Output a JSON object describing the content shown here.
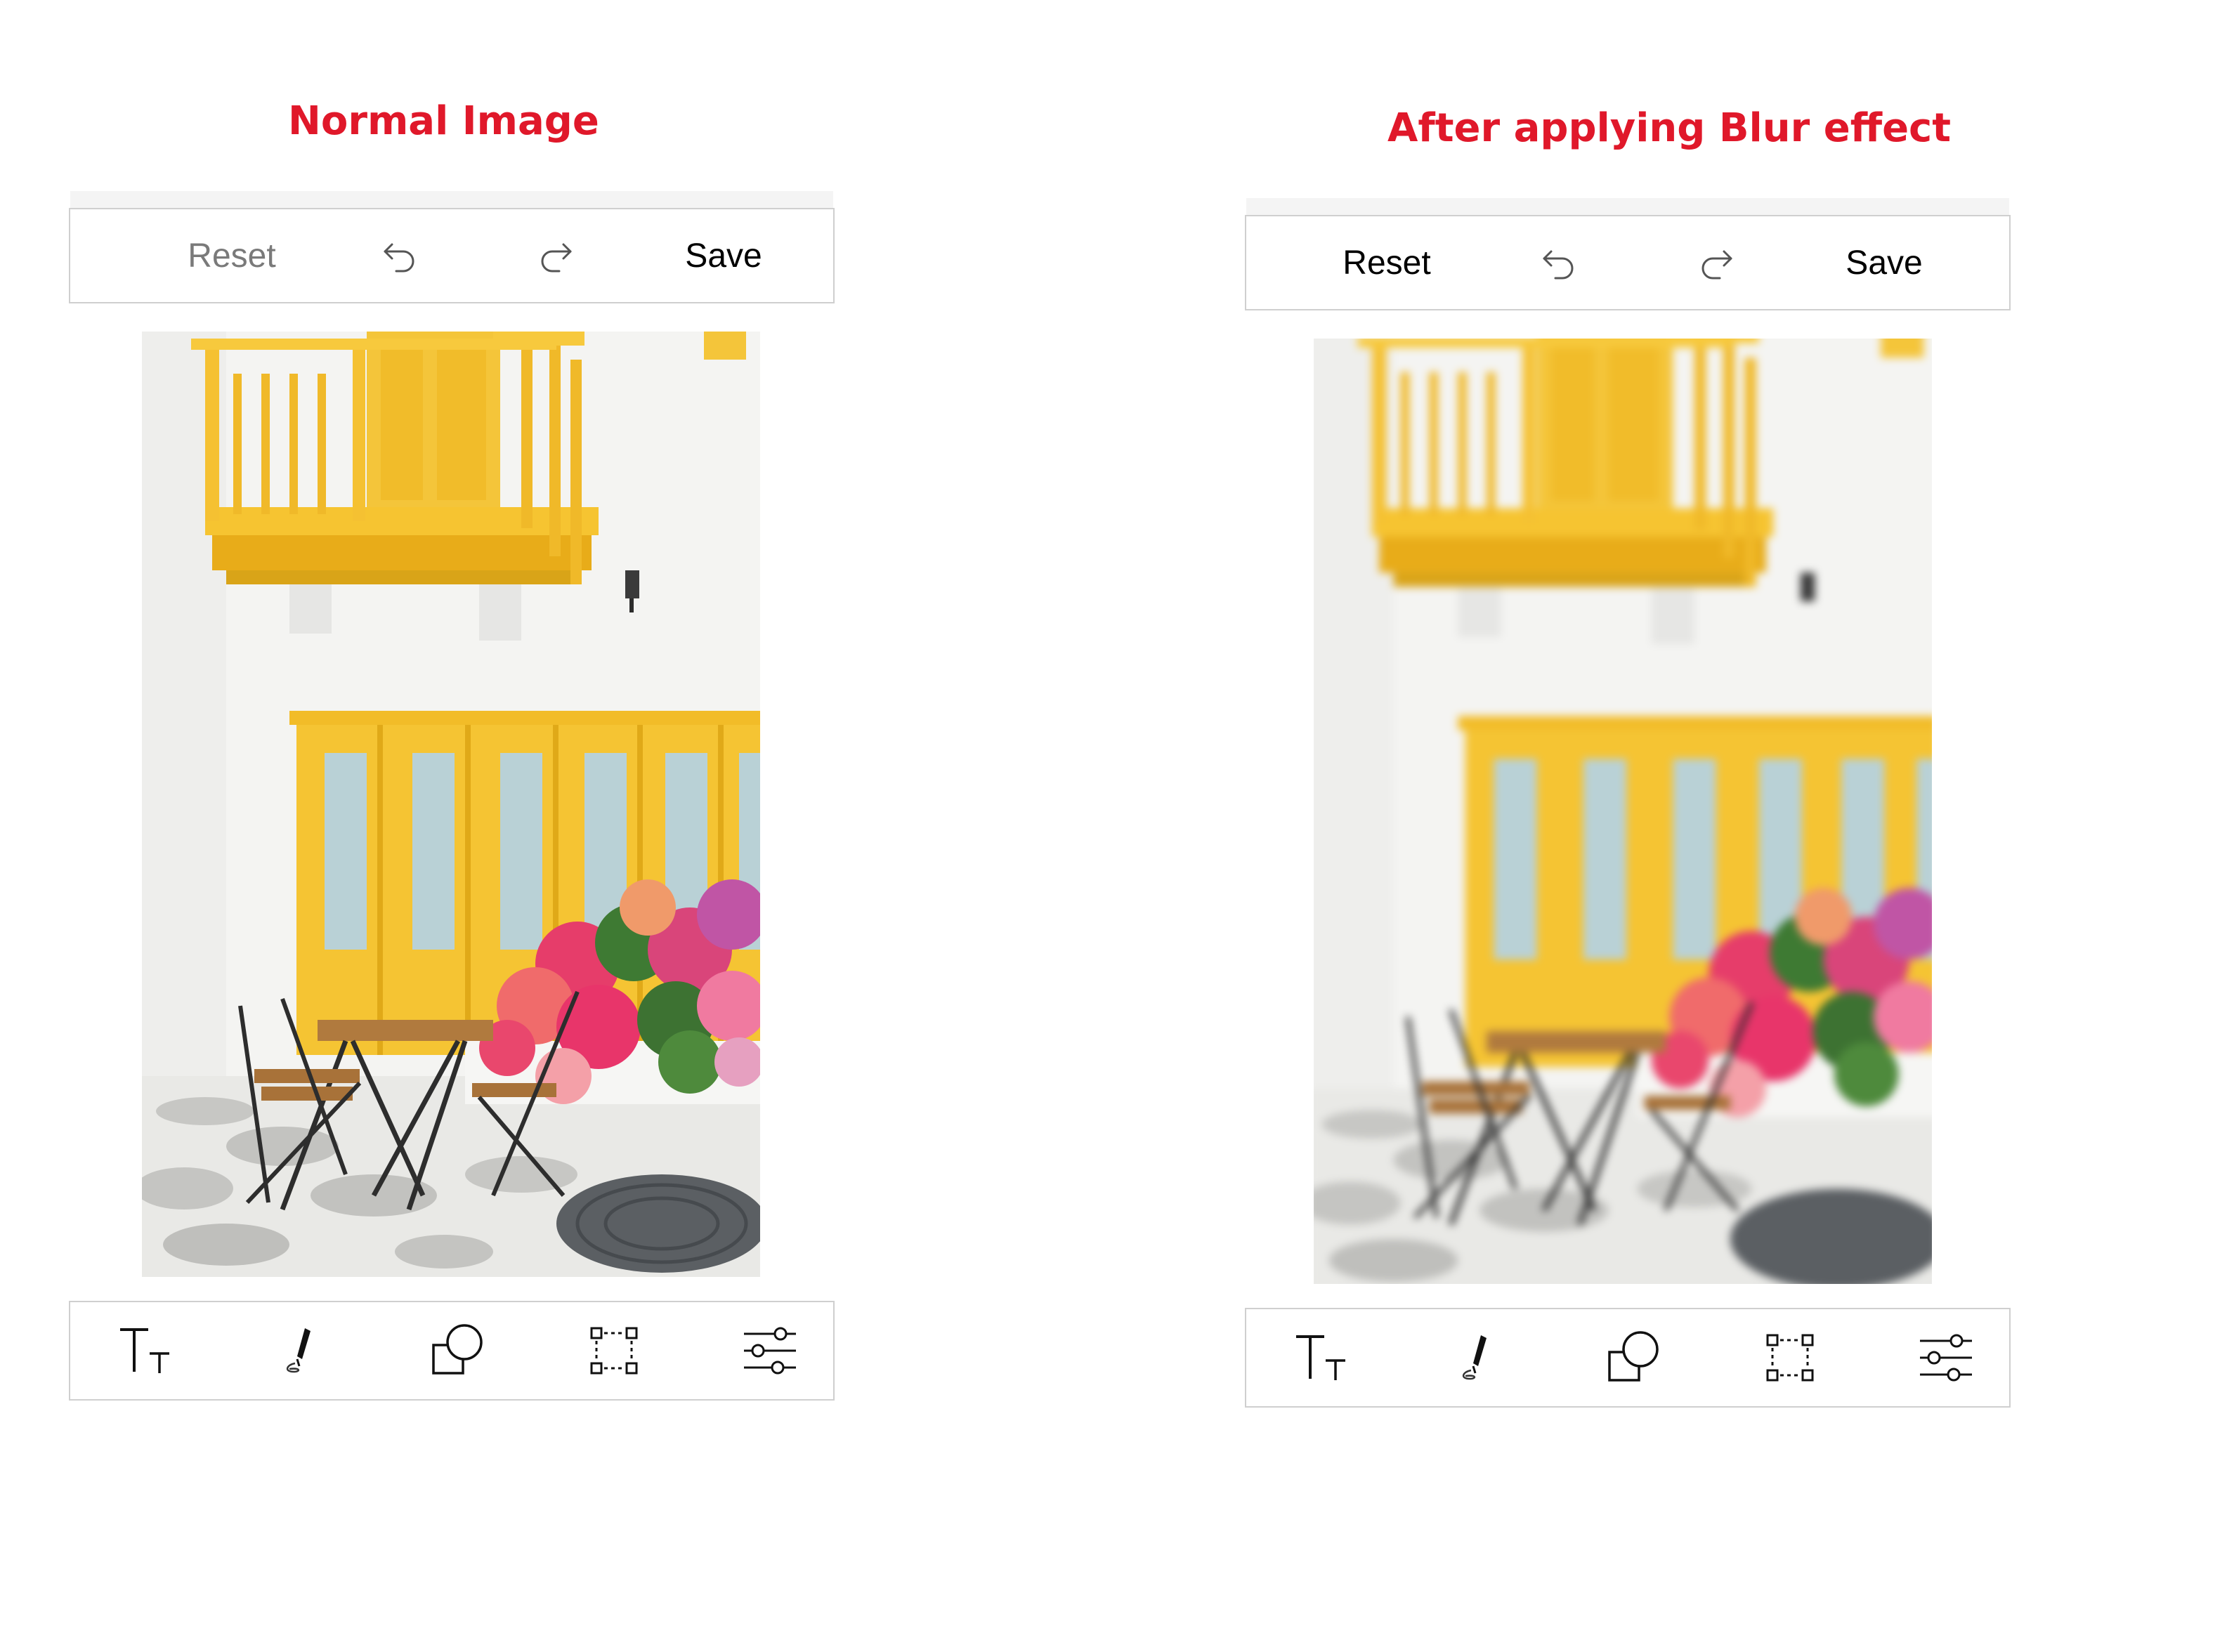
{
  "accent_color": "#e0182a",
  "panels": [
    {
      "title": "Normal Image",
      "toolbar": {
        "reset_label": "Reset",
        "reset_state": "disabled",
        "undo_icon": "undo-icon",
        "redo_icon": "redo-icon",
        "save_label": "Save"
      },
      "photo_filter": "none",
      "bottom_tools": [
        "text-icon",
        "pen-icon",
        "shapes-icon",
        "crop-icon",
        "filter-sliders-icon"
      ]
    },
    {
      "title": "After applying Blur effect",
      "toolbar": {
        "reset_label": "Reset",
        "reset_state": "enabled",
        "undo_icon": "undo-icon",
        "redo_icon": "redo-icon",
        "save_label": "Save"
      },
      "photo_filter": "blur",
      "bottom_tools": [
        "text-icon",
        "pen-icon",
        "shapes-icon",
        "crop-icon",
        "filter-sliders-icon"
      ]
    }
  ]
}
